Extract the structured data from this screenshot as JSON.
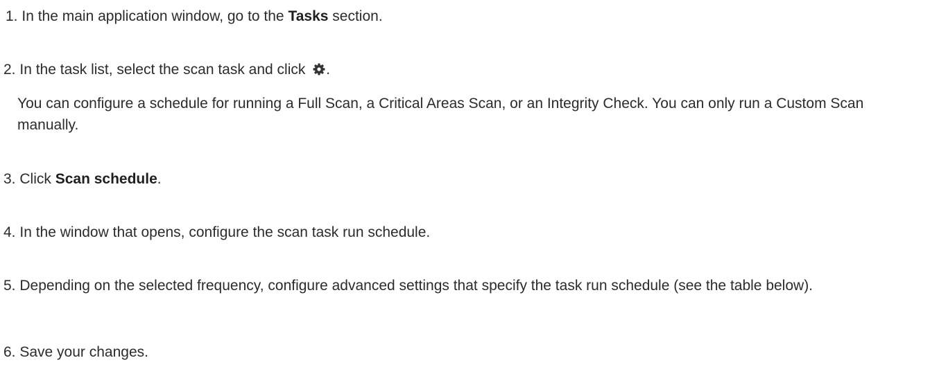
{
  "steps": [
    {
      "num": "1.",
      "pre": "In the main application window, go to the ",
      "bold": "Tasks",
      "post": " section."
    },
    {
      "num": "2.",
      "pre": "In the task list, select the scan task and click ",
      "icon": "gear-icon",
      "post": ".",
      "note": "You can configure a schedule for running a Full Scan, a Critical Areas Scan, or an Integrity Check. You can only run a Custom Scan manually."
    },
    {
      "num": "3.",
      "pre": "Click ",
      "bold": "Scan schedule",
      "post": "."
    },
    {
      "num": "4.",
      "text": "In the window that opens, configure the scan task run schedule."
    },
    {
      "num": "5.",
      "text": "Depending on the selected frequency, configure advanced settings that specify the task run schedule (see the table below)."
    },
    {
      "num": "6.",
      "text": "Save your changes."
    }
  ]
}
